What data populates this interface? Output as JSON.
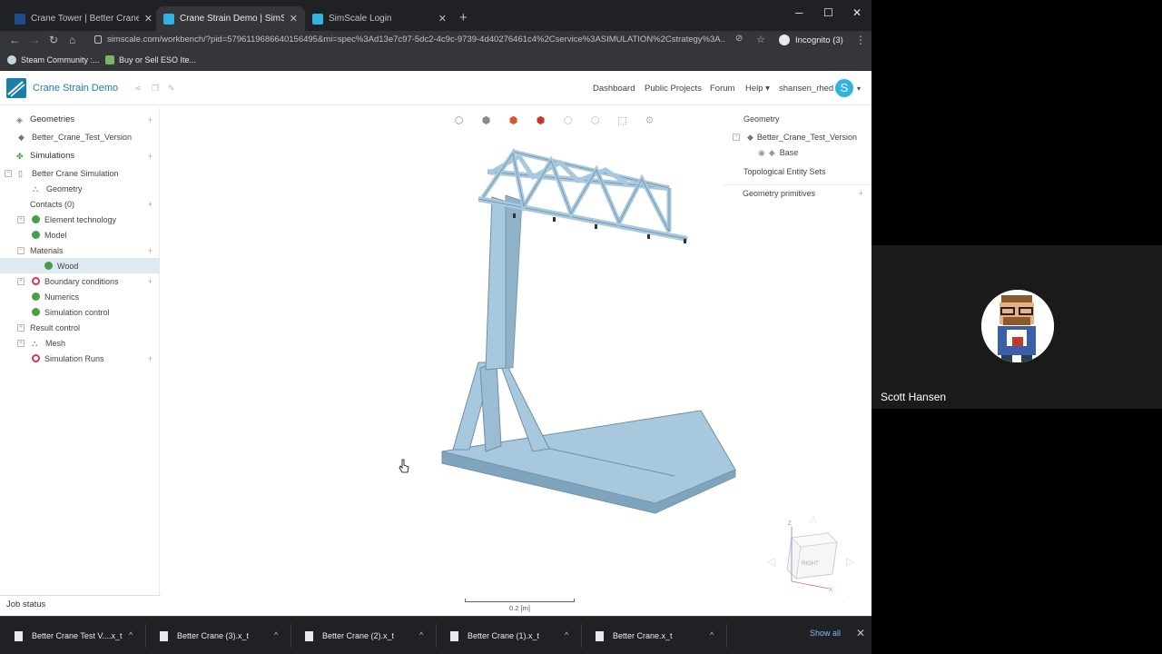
{
  "browser": {
    "tabs": [
      {
        "title": "Crane Tower | Better Crane Test V...",
        "active": false
      },
      {
        "title": "Crane Strain Demo | SimScale W...",
        "active": true
      },
      {
        "title": "SimScale Login",
        "active": false
      }
    ],
    "new_tab": "+",
    "window_controls": {
      "minimize": "─",
      "maximize": "☐",
      "close": "✕"
    },
    "url": "simscale.com/workbench/?pid=5796119686640156495&mi=spec%3Ad13e7c97-5dc2-4c9c-9739-4d40276461c4%2Cservice%3ASIMULATION%2Cstrategy%3A...",
    "incognito_label": "Incognito (3)",
    "bookmarks": [
      {
        "label": "Steam Community :..."
      },
      {
        "label": "Buy or Sell ESO Ite..."
      }
    ]
  },
  "app": {
    "project_title": "Crane Strain Demo",
    "nav": [
      "Dashboard",
      "Public Projects",
      "Forum",
      "Help ▾",
      "shansen_rhed"
    ],
    "avatar_letter": "S",
    "accent_color": "#1a7fa8"
  },
  "tree": {
    "geometries_header": "Geometries",
    "geometry_item": "Better_Crane_Test_Version",
    "simulations_header": "Simulations",
    "simulation_name": "Better Crane Simulation",
    "items": [
      {
        "label": "Geometry",
        "status": "geo"
      },
      {
        "label": "Contacts (0)",
        "status": "none"
      },
      {
        "label": "Element technology",
        "status": "ok"
      },
      {
        "label": "Model",
        "status": "ok"
      },
      {
        "label": "Materials",
        "status": "none"
      },
      {
        "label": "Wood",
        "status": "ok",
        "selected": true
      },
      {
        "label": "Boundary conditions",
        "status": "err"
      },
      {
        "label": "Numerics",
        "status": "ok"
      },
      {
        "label": "Simulation control",
        "status": "ok"
      },
      {
        "label": "Result control",
        "status": "none"
      },
      {
        "label": "Mesh",
        "status": "geo"
      },
      {
        "label": "Simulation Runs",
        "status": "err"
      }
    ]
  },
  "right_panel": {
    "geometry_header": "Geometry",
    "geometry_item": "Better_Crane_Test_Version",
    "base_label": "Base",
    "topological_sets": "Topological Entity Sets",
    "geometry_primitives": "Geometry primitives"
  },
  "viewport": {
    "scale_label": "0.2 [m]",
    "model_color": "#a8c8de",
    "orientation_cube_label": "RIGHT"
  },
  "job_status": "Job status",
  "downloads": [
    "Better Crane Test V....x_t",
    "Better Crane (3).x_t",
    "Better Crane (2).x_t",
    "Better Crane (1).x_t",
    "Better Crane.x_t"
  ],
  "show_all": "Show all",
  "call": {
    "name": "Scott Hansen"
  }
}
